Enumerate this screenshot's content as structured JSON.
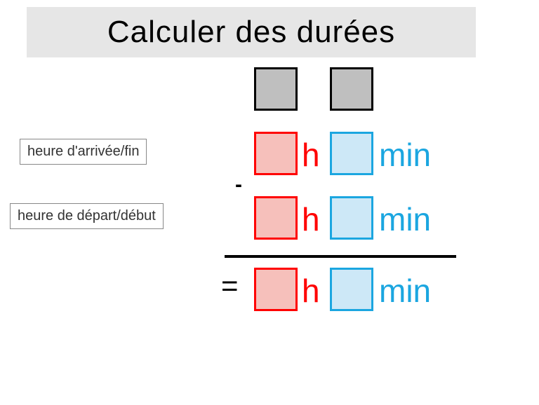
{
  "title": "Calculer des durées",
  "labels": {
    "arrival": "heure d'arrivée/fin",
    "departure": "heure de départ/début"
  },
  "units": {
    "h": "h",
    "min": "min"
  },
  "operators": {
    "minus": "-",
    "equals": "="
  },
  "colors": {
    "hours": "#ff0000",
    "minutes": "#1ba6e0",
    "grey_fill": "#bfbfbf",
    "red_fill": "#f6c0bb",
    "blue_fill": "#cde8f7",
    "title_bg": "#e6e6e6"
  }
}
